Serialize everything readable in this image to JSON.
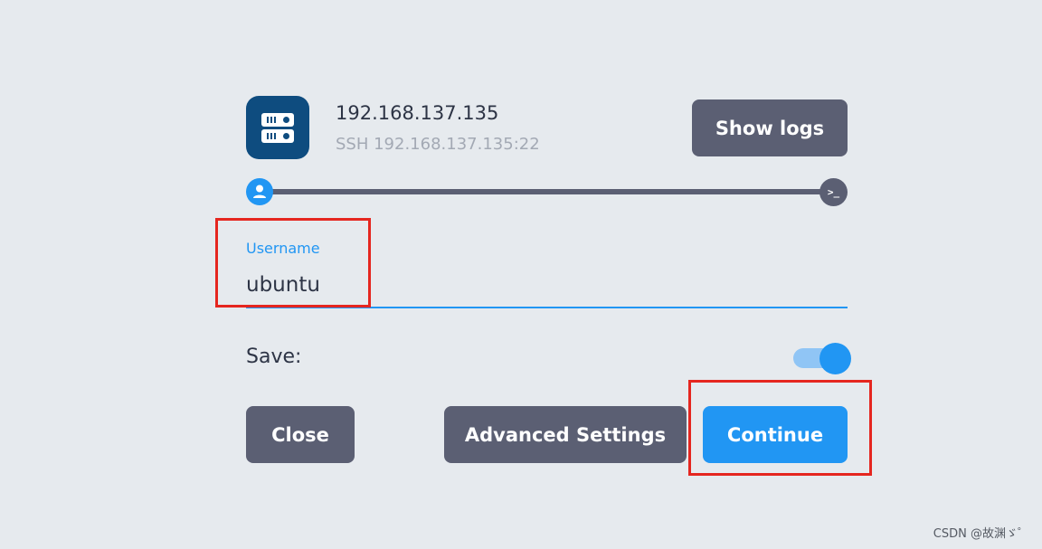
{
  "host": {
    "icon": "server-icon",
    "title": "192.168.137.135",
    "subtitle": "SSH 192.168.137.135:22"
  },
  "toolbar": {
    "show_logs_label": "Show logs"
  },
  "progress": {
    "steps": [
      {
        "icon": "user-icon",
        "state": "active"
      },
      {
        "icon": "terminal-icon",
        "label": ">_",
        "state": "pending"
      }
    ]
  },
  "form": {
    "username_label": "Username",
    "username_value": "ubuntu",
    "save_label": "Save:",
    "save_enabled": true
  },
  "actions": {
    "close_label": "Close",
    "advanced_label": "Advanced Settings",
    "continue_label": "Continue"
  },
  "colors": {
    "background": "#e6eaee",
    "accent": "#2196f3",
    "button_gray": "#5b5f73",
    "host_icon_bg": "#0e4c7f",
    "annotation_red": "#e5261f"
  },
  "watermark": "CSDN @故渊ゞ゜"
}
